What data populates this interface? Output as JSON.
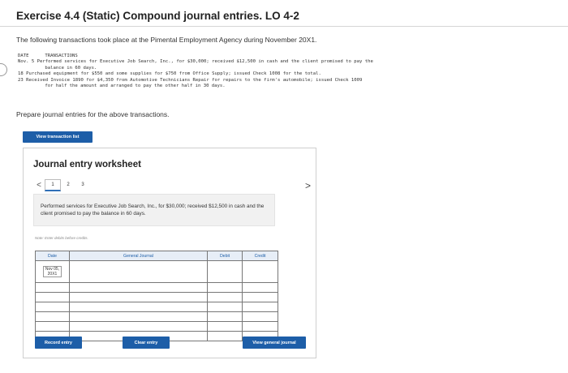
{
  "header": {
    "title": "Exercise 4.4 (Static) Compound journal entries. LO 4-2",
    "intro": "The following transactions took place at the Pimental Employment Agency during November 20X1."
  },
  "transactions": {
    "date_header": "DATE",
    "transactions_header": "TRANSACTIONS",
    "rows": [
      {
        "date": "Nov.  5",
        "text": "Performed services for Executive Job Search, Inc., for $30,000; received $12,500 in cash and the client promised to pay the"
      },
      {
        "date": "",
        "text": "  balance in 60 days."
      },
      {
        "date": "     18",
        "text": "Purchased equipment for $550 and some supplies for $750 from Office Supply; issued Check 1008 for the total."
      },
      {
        "date": "     23",
        "text": "Received Invoice 1890 for $4,350 from Automotive Technicians Repair for repairs to the firm's automobile; issued Check 1009"
      },
      {
        "date": "",
        "text": "  for half the amount and arranged to pay the other half in 30 days."
      }
    ]
  },
  "prepare_text": "Prepare journal entries for the above transactions.",
  "view_transaction_list_label": "View transaction list",
  "worksheet": {
    "title": "Journal entry worksheet",
    "nav": {
      "prev": "<",
      "pages": [
        "1",
        "2",
        "3"
      ],
      "active_page": 1,
      "next": ">"
    },
    "description": "Performed services for Executive Job Search, Inc., for $30,000; received $12,500 in cash and the client promised to pay the balance in 60 days.",
    "note": "Note: Enter debits before credits.",
    "table": {
      "headers": {
        "date": "Date",
        "account": "General Journal",
        "debit": "Debit",
        "credit": "Credit"
      },
      "first_date_line1": "Nov 05,",
      "first_date_line2": "20X1"
    },
    "buttons": {
      "record": "Record entry",
      "clear": "Clear entry",
      "view_general_journal": "View general journal"
    }
  },
  "colors": {
    "accent": "#1d5ea8",
    "header_bg": "#e7eef7"
  }
}
